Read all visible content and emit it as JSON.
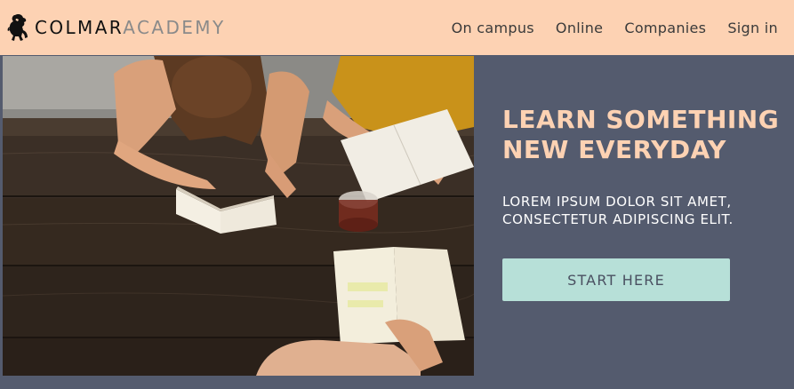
{
  "header": {
    "logo_icon": "lion-icon",
    "brand_primary": "COLMAR",
    "brand_secondary": "ACADEMY",
    "nav": [
      {
        "label": "On campus"
      },
      {
        "label": "Online"
      },
      {
        "label": "Companies"
      },
      {
        "label": "Sign in"
      }
    ],
    "background": "#fdd2b3"
  },
  "hero": {
    "image_icon": "students-studying-photo",
    "headline": "LEARN SOMETHING NEW EVERYDAY",
    "subheadline": "LOREM IPSUM DOLOR SIT AMET, CONSECTETUR ADIPISCING ELIT.",
    "cta_label": "START HERE"
  },
  "colors": {
    "accent": "#fdd2b3",
    "panel": "#545b6e",
    "cta": "#b7e0d8"
  }
}
